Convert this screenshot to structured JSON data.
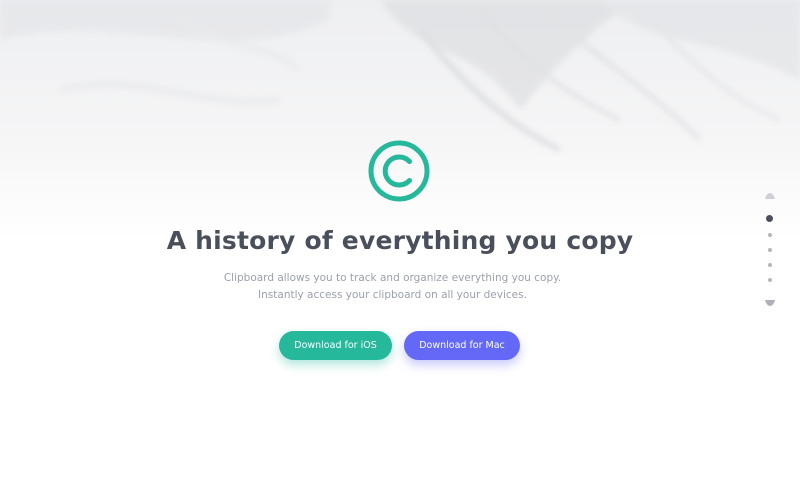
{
  "hero": {
    "logo_icon": "copyright-icon",
    "title": "A history of everything you copy",
    "description": "Clipboard allows you to track and organize everything you copy. Instantly access your clipboard on all your devices."
  },
  "buttons": {
    "ios": "Download for iOS",
    "mac": "Download for Mac"
  },
  "section_nav": {
    "up_icon": "chevron-up-icon",
    "down_icon": "chevron-down-icon",
    "dot_count": 5,
    "active_index": 0
  },
  "colors": {
    "accent_green": "#26b89b",
    "accent_blue": "#6369f6",
    "heading": "#4a4f5c",
    "body_text": "#9aa0ac"
  }
}
